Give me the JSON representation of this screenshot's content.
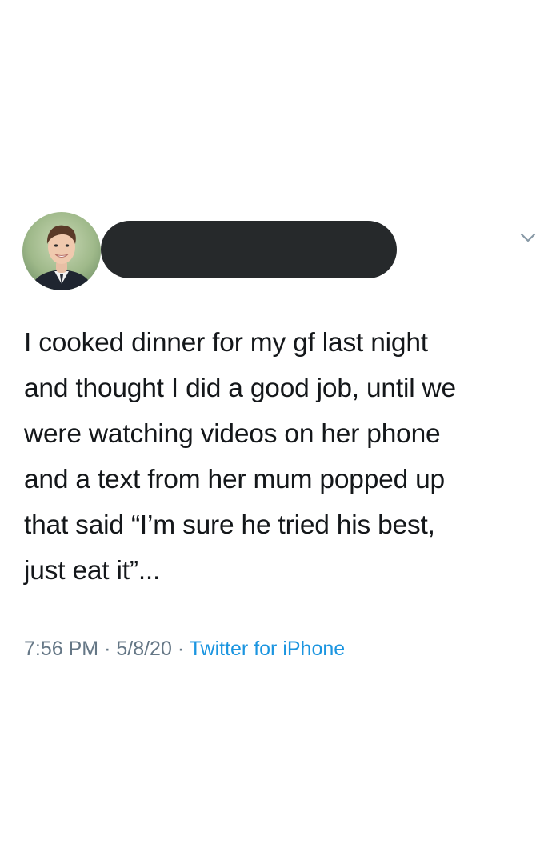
{
  "tweet": {
    "avatar_icon": "profile-photo",
    "menu_icon": "chevron-down-icon",
    "text_lines": [
      "I cooked dinner for my gf last night",
      "and thought I did a good job, until we",
      "were watching videos on her phone",
      "and a text from her mum popped up",
      "that said “I’m sure he tried his best,",
      "just eat it”..."
    ],
    "time": "7:56 PM",
    "separator": "·",
    "date": "5/8/20",
    "source": "Twitter for iPhone"
  },
  "colors": {
    "text": "#14171a",
    "meta": "#657786",
    "link": "#1b95e0",
    "redaction": "#26292b"
  }
}
